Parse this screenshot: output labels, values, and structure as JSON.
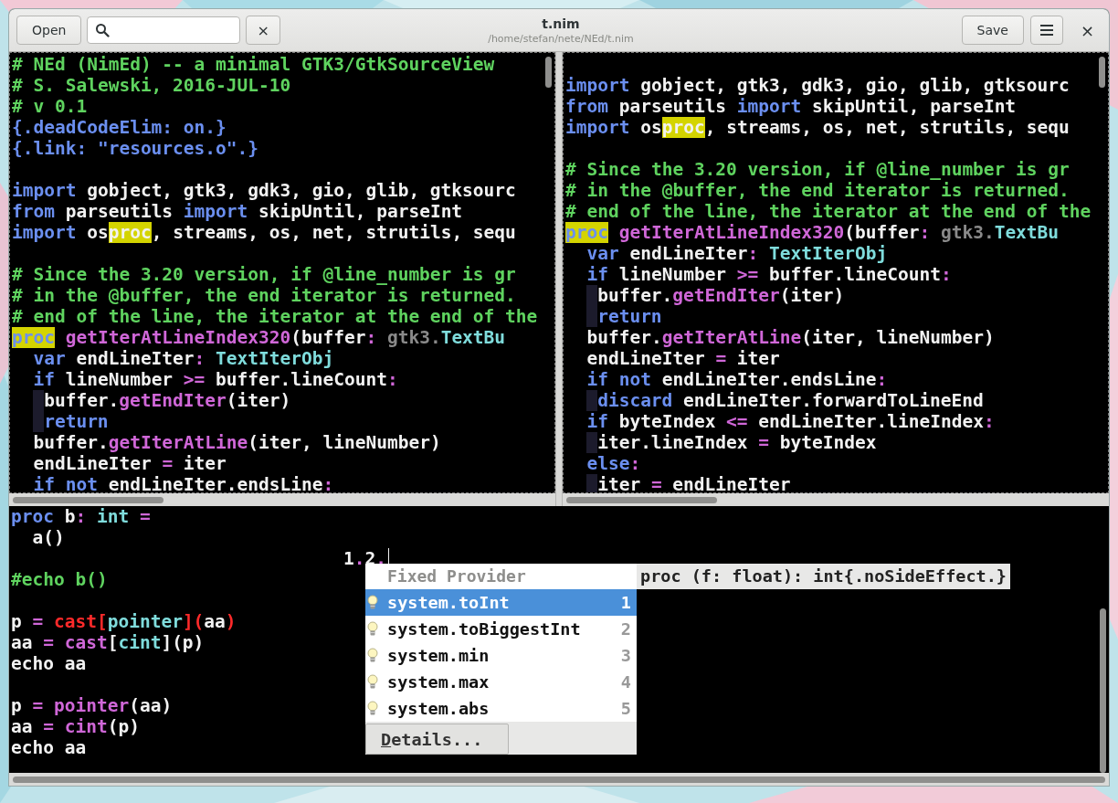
{
  "header": {
    "open_button": "Open",
    "clear_button": "×",
    "title": "t.nim",
    "subtitle": "/home/stefan/nete/NEd/t.nim",
    "save_button": "Save",
    "close_button": "×"
  },
  "editors": [
    {
      "lines": [
        {
          "kind": "code",
          "tokens": [
            {
              "t": "# NEd (NimEd) -- a minimal GTK3/GtkSourceView",
              "kind": "comment"
            }
          ]
        },
        {
          "kind": "code",
          "tokens": [
            {
              "t": "# S. Salewski, 2016-JUL-10",
              "kind": "comment"
            }
          ]
        },
        {
          "kind": "code",
          "tokens": [
            {
              "t": "# v 0.1",
              "kind": "comment"
            }
          ]
        },
        {
          "kind": "code",
          "tokens": [
            {
              "t": "{.deadCodeElim: on.}",
              "kind": "kw"
            }
          ]
        },
        {
          "kind": "code",
          "tokens": [
            {
              "t": "{.link: \"resources.o\".}",
              "kind": "kw"
            }
          ]
        },
        {
          "kind": "blank"
        },
        {
          "kind": "code",
          "tokens": [
            {
              "t": "import",
              "kind": "kw"
            },
            {
              "t": " gobject, gtk3, gdk3, gio, glib, gtksourc",
              "kind": "plain"
            }
          ]
        },
        {
          "kind": "code",
          "tokens": [
            {
              "t": "from",
              "kind": "kw"
            },
            {
              "t": " parseutils ",
              "kind": "plain"
            },
            {
              "t": "import",
              "kind": "kw"
            },
            {
              "t": " skipUntil, parseInt",
              "kind": "plain"
            }
          ]
        },
        {
          "kind": "code",
          "tokens": [
            {
              "t": "import",
              "kind": "kw"
            },
            {
              "t": " os",
              "kind": "plain"
            },
            {
              "t": "proc",
              "kind": "match"
            },
            {
              "t": ", streams, os, net, strutils, sequ",
              "kind": "plain"
            }
          ]
        },
        {
          "kind": "blank"
        },
        {
          "kind": "code",
          "tokens": [
            {
              "t": "# Since the 3.20 version, if @line_number is gr",
              "kind": "comment"
            }
          ]
        },
        {
          "kind": "code",
          "tokens": [
            {
              "t": "# in the @buffer, the end iterator is returned.",
              "kind": "comment"
            }
          ]
        },
        {
          "kind": "code",
          "tokens": [
            {
              "t": "# end of the line, the iterator at the end of the",
              "kind": "comment"
            }
          ]
        },
        {
          "kind": "code",
          "tokens": [
            {
              "t": "proc",
              "kind": "kw-match"
            },
            {
              "t": " getIterAtLineIndex320",
              "kind": "fn"
            },
            {
              "t": "(buffer",
              "kind": "plain"
            },
            {
              "t": ":",
              "kind": "op"
            },
            {
              "t": " gtk3.",
              "kind": "dim"
            },
            {
              "t": "TextBu",
              "kind": "type"
            }
          ]
        },
        {
          "kind": "code",
          "tokens": [
            {
              "t": "  var",
              "kind": "kw"
            },
            {
              "t": " endLineIter",
              "kind": "plain"
            },
            {
              "t": ":",
              "kind": "op"
            },
            {
              "t": " TextIterObj",
              "kind": "type"
            }
          ]
        },
        {
          "kind": "code",
          "tokens": [
            {
              "t": "  if",
              "kind": "kw"
            },
            {
              "t": " lineNumber ",
              "kind": "plain"
            },
            {
              "t": ">=",
              "kind": "op"
            },
            {
              "t": " buffer.lineCount",
              "kind": "plain"
            },
            {
              "t": ":",
              "kind": "op"
            }
          ]
        },
        {
          "kind": "code",
          "guide": true,
          "tokens": [
            {
              "t": "  buffer.",
              "kind": "plain"
            },
            {
              "t": "getEndIter",
              "kind": "fn"
            },
            {
              "t": "(iter)",
              "kind": "plain"
            }
          ]
        },
        {
          "kind": "code",
          "guide": true,
          "tokens": [
            {
              "t": "  return",
              "kind": "kw"
            }
          ]
        },
        {
          "kind": "code",
          "tokens": [
            {
              "t": "  buffer.",
              "kind": "plain"
            },
            {
              "t": "getIterAtLine",
              "kind": "fn"
            },
            {
              "t": "(iter, lineNumber)",
              "kind": "plain"
            }
          ]
        },
        {
          "kind": "code",
          "tokens": [
            {
              "t": "  endLineIter ",
              "kind": "plain"
            },
            {
              "t": "=",
              "kind": "op"
            },
            {
              "t": " iter",
              "kind": "plain"
            }
          ]
        },
        {
          "kind": "code",
          "tokens": [
            {
              "t": "  if not",
              "kind": "kw"
            },
            {
              "t": " endLineIter.endsLine",
              "kind": "plain"
            },
            {
              "t": ":",
              "kind": "op"
            }
          ]
        }
      ]
    },
    {
      "lines": [
        {
          "kind": "blank"
        },
        {
          "kind": "code",
          "tokens": [
            {
              "t": "import",
              "kind": "kw"
            },
            {
              "t": " gobject, gtk3, gdk3, gio, glib, gtksourc",
              "kind": "plain"
            }
          ]
        },
        {
          "kind": "code",
          "tokens": [
            {
              "t": "from",
              "kind": "kw"
            },
            {
              "t": " parseutils ",
              "kind": "plain"
            },
            {
              "t": "import",
              "kind": "kw"
            },
            {
              "t": " skipUntil, parseInt",
              "kind": "plain"
            }
          ]
        },
        {
          "kind": "code",
          "tokens": [
            {
              "t": "import",
              "kind": "kw"
            },
            {
              "t": " os",
              "kind": "plain"
            },
            {
              "t": "proc",
              "kind": "match"
            },
            {
              "t": ", streams, os, net, strutils, sequ",
              "kind": "plain"
            }
          ]
        },
        {
          "kind": "blank"
        },
        {
          "kind": "code",
          "tokens": [
            {
              "t": "# Since the 3.20 version, if @line_number is gr",
              "kind": "comment"
            }
          ]
        },
        {
          "kind": "code",
          "tokens": [
            {
              "t": "# in the @buffer, the end iterator is returned.",
              "kind": "comment"
            }
          ]
        },
        {
          "kind": "code",
          "tokens": [
            {
              "t": "# end of the line, the iterator at the end of the",
              "kind": "comment"
            }
          ]
        },
        {
          "kind": "code",
          "tokens": [
            {
              "t": "proc",
              "kind": "kw-match"
            },
            {
              "t": " getIterAtLineIndex320",
              "kind": "fn"
            },
            {
              "t": "(buffer",
              "kind": "plain"
            },
            {
              "t": ":",
              "kind": "op"
            },
            {
              "t": " gtk3.",
              "kind": "dim"
            },
            {
              "t": "TextBu",
              "kind": "type"
            }
          ]
        },
        {
          "kind": "code",
          "tokens": [
            {
              "t": "  var",
              "kind": "kw"
            },
            {
              "t": " endLineIter",
              "kind": "plain"
            },
            {
              "t": ":",
              "kind": "op"
            },
            {
              "t": " TextIterObj",
              "kind": "type"
            }
          ]
        },
        {
          "kind": "code",
          "tokens": [
            {
              "t": "  if",
              "kind": "kw"
            },
            {
              "t": " lineNumber ",
              "kind": "plain"
            },
            {
              "t": ">=",
              "kind": "op"
            },
            {
              "t": " buffer.lineCount",
              "kind": "plain"
            },
            {
              "t": ":",
              "kind": "op"
            }
          ]
        },
        {
          "kind": "code",
          "guide": true,
          "tokens": [
            {
              "t": "  buffer.",
              "kind": "plain"
            },
            {
              "t": "getEndIter",
              "kind": "fn"
            },
            {
              "t": "(iter)",
              "kind": "plain"
            }
          ]
        },
        {
          "kind": "code",
          "guide": true,
          "tokens": [
            {
              "t": "  return",
              "kind": "kw"
            }
          ]
        },
        {
          "kind": "code",
          "tokens": [
            {
              "t": "  buffer.",
              "kind": "plain"
            },
            {
              "t": "getIterAtLine",
              "kind": "fn"
            },
            {
              "t": "(iter, lineNumber)",
              "kind": "plain"
            }
          ]
        },
        {
          "kind": "code",
          "tokens": [
            {
              "t": "  endLineIter ",
              "kind": "plain"
            },
            {
              "t": "=",
              "kind": "op"
            },
            {
              "t": " iter",
              "kind": "plain"
            }
          ]
        },
        {
          "kind": "code",
          "tokens": [
            {
              "t": "  if not",
              "kind": "kw"
            },
            {
              "t": " endLineIter.endsLine",
              "kind": "plain"
            },
            {
              "t": ":",
              "kind": "op"
            }
          ]
        },
        {
          "kind": "code",
          "guide": true,
          "tokens": [
            {
              "t": "  discard",
              "kind": "kw"
            },
            {
              "t": " endLineIter.forwardToLineEnd",
              "kind": "plain"
            }
          ]
        },
        {
          "kind": "code",
          "tokens": [
            {
              "t": "  if",
              "kind": "kw"
            },
            {
              "t": " byteIndex ",
              "kind": "plain"
            },
            {
              "t": "<=",
              "kind": "op"
            },
            {
              "t": " endLineIter.lineIndex",
              "kind": "plain"
            },
            {
              "t": ":",
              "kind": "op"
            }
          ]
        },
        {
          "kind": "code",
          "guide": true,
          "tokens": [
            {
              "t": "  iter.lineIndex ",
              "kind": "plain"
            },
            {
              "t": "=",
              "kind": "op"
            },
            {
              "t": " byteIndex",
              "kind": "plain"
            }
          ]
        },
        {
          "kind": "code",
          "tokens": [
            {
              "t": "  else",
              "kind": "kw"
            },
            {
              "t": ":",
              "kind": "op"
            }
          ]
        },
        {
          "kind": "code",
          "guide": true,
          "tokens": [
            {
              "t": "  iter ",
              "kind": "plain"
            },
            {
              "t": "=",
              "kind": "op"
            },
            {
              "t": " endLineIter",
              "kind": "plain"
            }
          ]
        }
      ]
    }
  ],
  "bottom_editor": {
    "lines": [
      {
        "kind": "code",
        "tokens": [
          {
            "t": "proc",
            "kind": "kw"
          },
          {
            "t": " b",
            "kind": "plain"
          },
          {
            "t": ":",
            "kind": "op"
          },
          {
            "t": " int",
            "kind": "type"
          },
          {
            "t": " =",
            "kind": "op"
          }
        ]
      },
      {
        "kind": "code",
        "tokens": [
          {
            "t": "  a()",
            "kind": "plain"
          }
        ]
      },
      {
        "kind": "code",
        "cursor": true,
        "tokens": [
          {
            "t": "                               1",
            "kind": "plain"
          },
          {
            "t": ".",
            "kind": "op"
          },
          {
            "t": "2",
            "kind": "plain"
          },
          {
            "t": ".",
            "kind": "op"
          }
        ]
      },
      {
        "kind": "code",
        "tokens": [
          {
            "t": "#echo b()",
            "kind": "comment"
          }
        ]
      },
      {
        "kind": "blank"
      },
      {
        "kind": "code",
        "tokens": [
          {
            "t": "p",
            "kind": "plain"
          },
          {
            "t": " =",
            "kind": "op"
          },
          {
            "t": " cast[",
            "kind": "err"
          },
          {
            "t": "pointer",
            "kind": "type"
          },
          {
            "t": "](",
            "kind": "err"
          },
          {
            "t": "aa",
            "kind": "plain"
          },
          {
            "t": ")",
            "kind": "err"
          }
        ]
      },
      {
        "kind": "code",
        "tokens": [
          {
            "t": "aa",
            "kind": "plain"
          },
          {
            "t": " =",
            "kind": "op"
          },
          {
            "t": " cast",
            "kind": "fn"
          },
          {
            "t": "[",
            "kind": "plain"
          },
          {
            "t": "cint",
            "kind": "type"
          },
          {
            "t": "](p)",
            "kind": "plain"
          }
        ]
      },
      {
        "kind": "code",
        "tokens": [
          {
            "t": "echo aa",
            "kind": "plain"
          }
        ]
      },
      {
        "kind": "blank"
      },
      {
        "kind": "code",
        "tokens": [
          {
            "t": "p",
            "kind": "plain"
          },
          {
            "t": " =",
            "kind": "op"
          },
          {
            "t": " pointer",
            "kind": "fn"
          },
          {
            "t": "(aa)",
            "kind": "plain"
          }
        ]
      },
      {
        "kind": "code",
        "tokens": [
          {
            "t": "aa",
            "kind": "plain"
          },
          {
            "t": " =",
            "kind": "op"
          },
          {
            "t": " cint",
            "kind": "fn"
          },
          {
            "t": "(p)",
            "kind": "plain"
          }
        ]
      },
      {
        "kind": "code",
        "tokens": [
          {
            "t": "echo aa",
            "kind": "plain"
          }
        ]
      }
    ]
  },
  "completion": {
    "provider": "Fixed Provider",
    "items": [
      {
        "label": "system.toInt",
        "number": "1",
        "selected": true
      },
      {
        "label": "system.toBiggestInt",
        "number": "2",
        "selected": false
      },
      {
        "label": "system.min",
        "number": "3",
        "selected": false
      },
      {
        "label": "system.max",
        "number": "4",
        "selected": false
      },
      {
        "label": "system.abs",
        "number": "5",
        "selected": false
      }
    ],
    "details_button": "Details...",
    "info": "proc (f: float): int{.noSideEffect.}"
  }
}
